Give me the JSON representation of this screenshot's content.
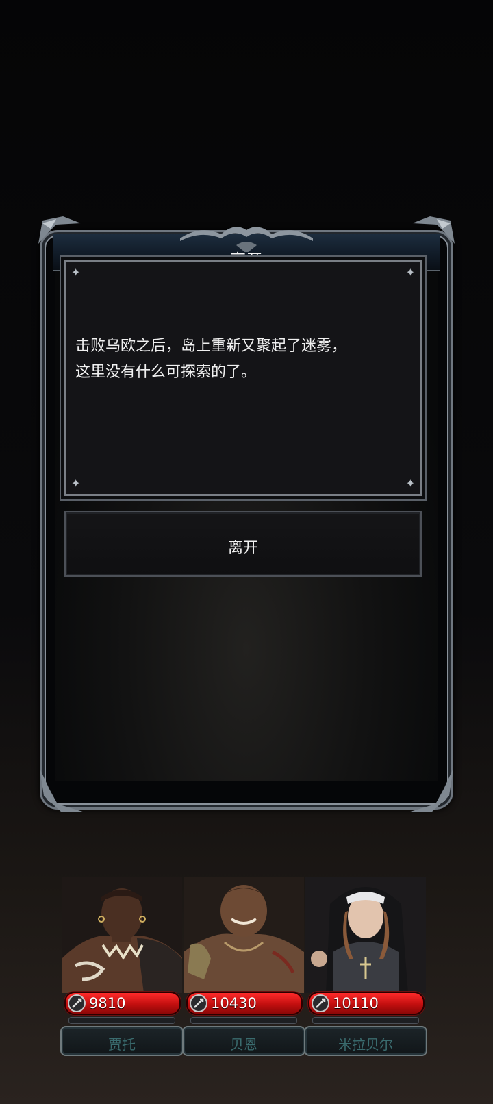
{
  "dialog": {
    "title": "离开",
    "message_line1": "击败乌欧之后，岛上重新又聚起了迷雾，",
    "message_line2": "这里没有什么可探索的了。",
    "leave_button_label": "离开"
  },
  "party": [
    {
      "name": "贾托",
      "hp": "9810"
    },
    {
      "name": "贝恩",
      "hp": "10430"
    },
    {
      "name": "米拉贝尔",
      "hp": "10110"
    }
  ],
  "colors": {
    "hp_bar": "#d01414",
    "title_bar": "#1a2a3a",
    "frame": "#7a838c",
    "name_text": "#3a6b6e"
  }
}
